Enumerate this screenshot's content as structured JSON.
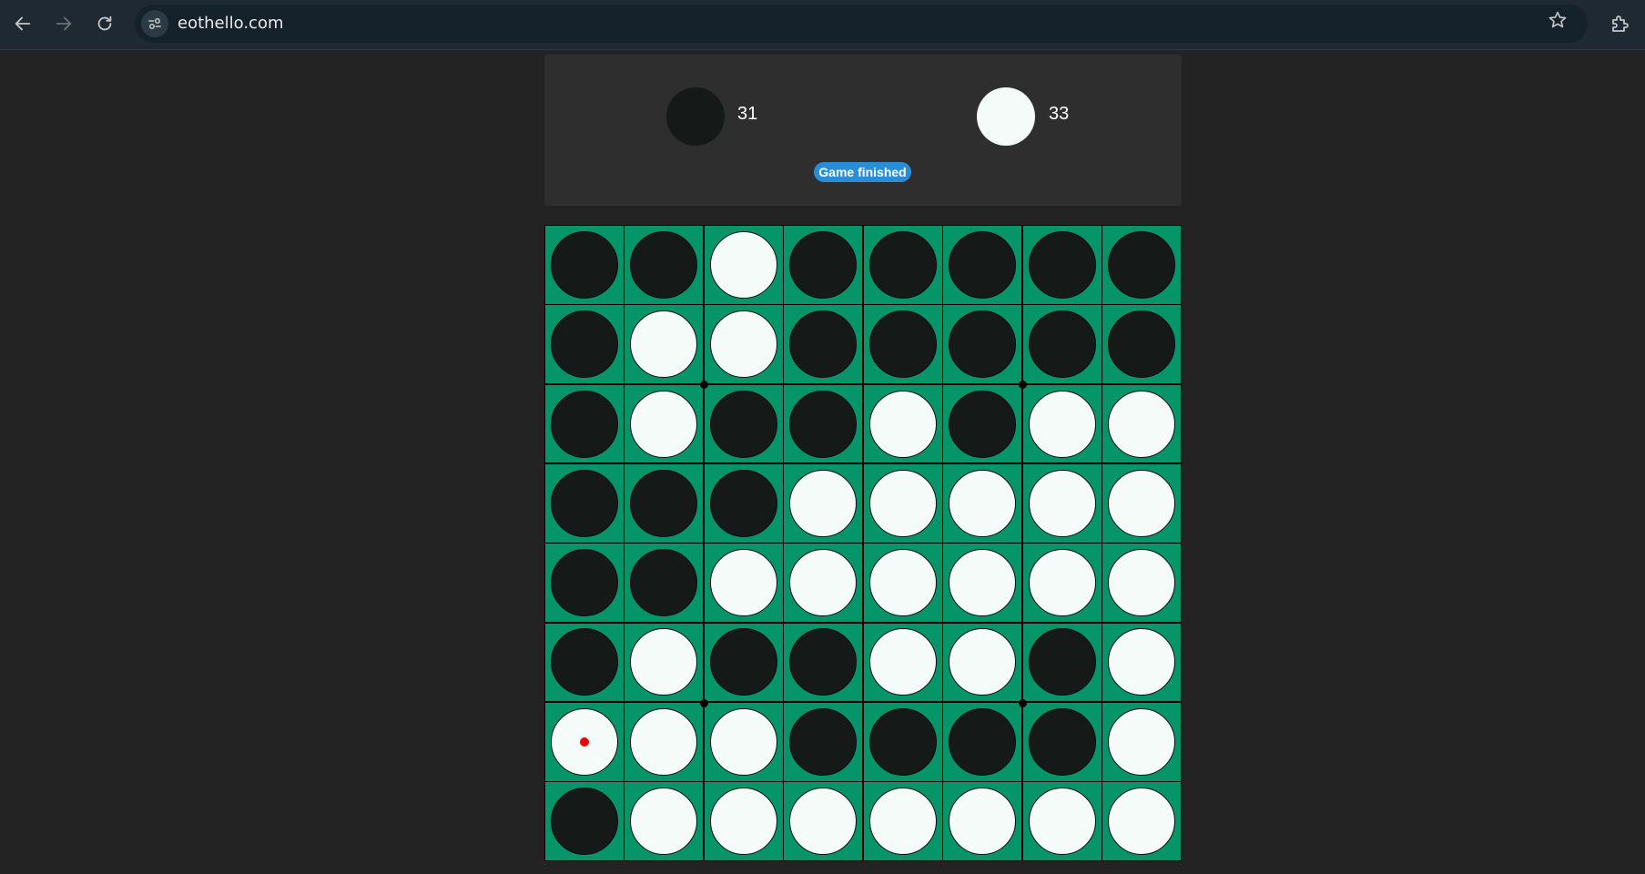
{
  "browser": {
    "url": "eothello.com"
  },
  "score": {
    "black": "31",
    "white": "33",
    "status": "Game finished"
  },
  "colors": {
    "board_green": "#069469",
    "black_disc": "#151917",
    "white_disc": "#f4fbf8",
    "badge_blue": "#2a8ed6",
    "last_move_marker": "#ee0000"
  },
  "board": {
    "rows": [
      [
        "B",
        "B",
        "W",
        "B",
        "B",
        "B",
        "B",
        "B"
      ],
      [
        "B",
        "W",
        "W",
        "B",
        "B",
        "B",
        "B",
        "B"
      ],
      [
        "B",
        "W",
        "B",
        "B",
        "W",
        "B",
        "W",
        "W"
      ],
      [
        "B",
        "B",
        "B",
        "W",
        "W",
        "W",
        "W",
        "W"
      ],
      [
        "B",
        "B",
        "W",
        "W",
        "W",
        "W",
        "W",
        "W"
      ],
      [
        "B",
        "W",
        "B",
        "B",
        "W",
        "W",
        "B",
        "W"
      ],
      [
        "W",
        "W",
        "W",
        "B",
        "B",
        "B",
        "B",
        "W"
      ],
      [
        "B",
        "W",
        "W",
        "W",
        "W",
        "W",
        "W",
        "W"
      ]
    ],
    "last_move": {
      "row": 7,
      "col": "a"
    }
  }
}
